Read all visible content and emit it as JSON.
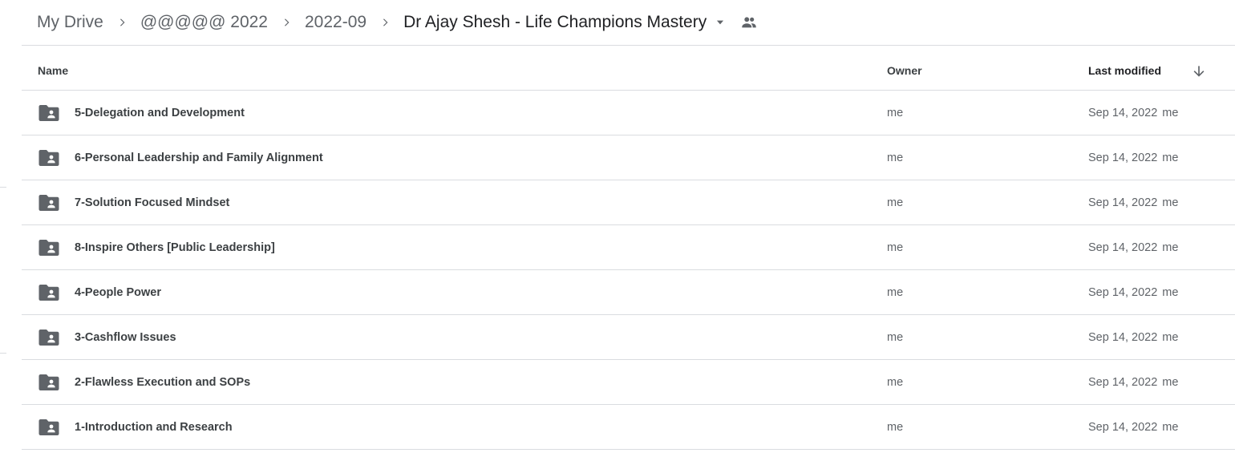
{
  "breadcrumb": {
    "items": [
      {
        "label": "My Drive"
      },
      {
        "label": "@@@@@ 2022"
      },
      {
        "label": "2022-09"
      },
      {
        "label": "Dr Ajay Shesh - Life Champions Mastery"
      }
    ],
    "separator_icon": "chevron-right-icon",
    "dropdown_icon": "caret-down-icon",
    "shared_icon": "people-icon"
  },
  "table": {
    "headers": {
      "name": "Name",
      "owner": "Owner",
      "last_modified": "Last modified",
      "sort_icon": "arrow-down-icon"
    },
    "rows": [
      {
        "name": "5-Delegation and Development",
        "owner": "me",
        "date": "Sep 14, 2022",
        "modified_by": "me"
      },
      {
        "name": "6-Personal Leadership and Family Alignment",
        "owner": "me",
        "date": "Sep 14, 2022",
        "modified_by": "me"
      },
      {
        "name": "7-Solution Focused Mindset",
        "owner": "me",
        "date": "Sep 14, 2022",
        "modified_by": "me"
      },
      {
        "name": "8-Inspire Others [Public Leadership]",
        "owner": "me",
        "date": "Sep 14, 2022",
        "modified_by": "me"
      },
      {
        "name": "4-People Power",
        "owner": "me",
        "date": "Sep 14, 2022",
        "modified_by": "me"
      },
      {
        "name": "3-Cashflow Issues",
        "owner": "me",
        "date": "Sep 14, 2022",
        "modified_by": "me"
      },
      {
        "name": "2-Flawless Execution and SOPs",
        "owner": "me",
        "date": "Sep 14, 2022",
        "modified_by": "me"
      },
      {
        "name": "1-Introduction and Research",
        "owner": "me",
        "date": "Sep 14, 2022",
        "modified_by": "me"
      }
    ],
    "row_icon": "shared-folder-icon"
  },
  "colors": {
    "text_primary": "#202124",
    "text_secondary": "#5f6368",
    "divider": "#dadce0",
    "icon": "#5f6368"
  }
}
